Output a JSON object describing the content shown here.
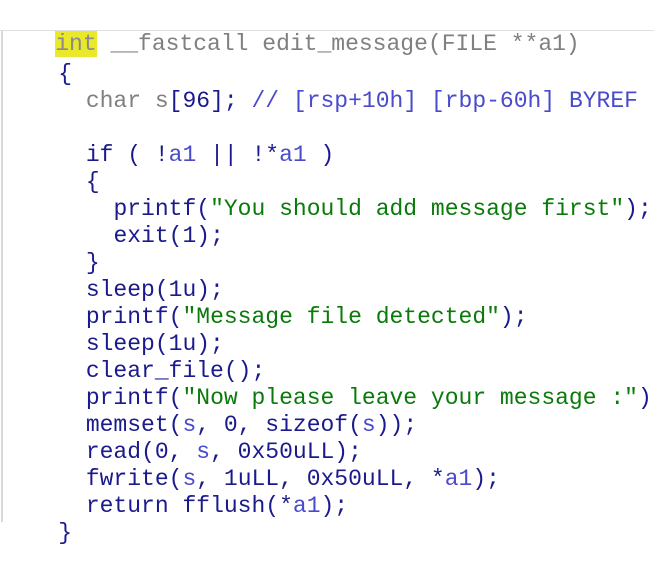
{
  "code": {
    "signature": {
      "type": "int",
      "rest": " __fastcall edit_message(FILE **a1)"
    },
    "open_brace": "{",
    "decl": {
      "type": "char",
      "name": " s",
      "dim": "[96]",
      "semi": ";",
      "comment": " // [rsp+10h] [rbp-60h] BYREF"
    },
    "if_kw": "if",
    "if_open": " ( !",
    "if_a1": "a1",
    "if_mid": " || !*",
    "if_a1b": "a1",
    "if_close": " )",
    "inner_open": "{",
    "printf1_fn": "printf",
    "printf1_str": "\"You should add message first\"",
    "printf1_end": ");",
    "exit_fn": "exit",
    "exit_args": "(1);",
    "inner_close": "}",
    "sleep1_fn": "sleep",
    "sleep1_args": "(1u);",
    "printf2_fn": "printf",
    "printf2_str": "\"Message file detected\"",
    "printf2_end": ");",
    "sleep2_fn": "sleep",
    "sleep2_args": "(1u);",
    "clear_fn": "clear_file",
    "clear_args": "();",
    "printf3_fn": "printf",
    "printf3_str": "\"Now please leave your message :\"",
    "printf3_end": ");",
    "memset_fn": "memset",
    "memset_s": "s",
    "memset_mid": ", 0, sizeof(",
    "memset_s2": "s",
    "memset_end": "));",
    "read_fn": "read",
    "read_a": "(0, ",
    "read_s": "s",
    "read_end": ", 0x50uLL);",
    "fwrite_fn": "fwrite",
    "fwrite_s": "s",
    "fwrite_mid": ", 1uLL, 0x50uLL, *",
    "fwrite_a1": "a1",
    "fwrite_end": ");",
    "return_kw": "return",
    "fflush_fn": " fflush",
    "fflush_open": "(*",
    "fflush_a1": "a1",
    "fflush_end": ");",
    "close_brace": "}"
  }
}
